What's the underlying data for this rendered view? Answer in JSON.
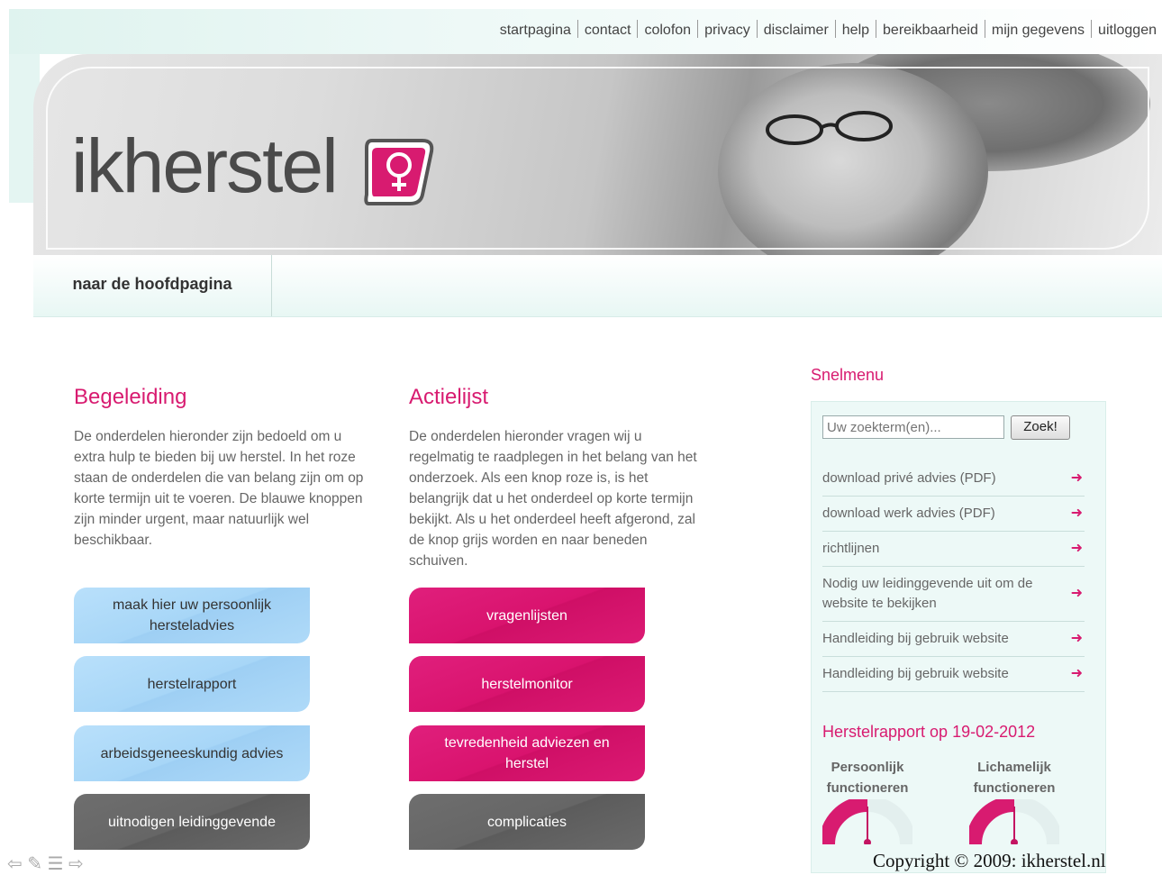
{
  "topnav": [
    "startpagina",
    "contact",
    "colofon",
    "privacy",
    "disclaimer",
    "help",
    "bereikbaarheid",
    "mijn gegevens",
    "uitloggen"
  ],
  "logo": {
    "text": "ikherstel",
    "icon": "female-symbol-leaf-icon"
  },
  "subnav": {
    "home": "naar de hoofdpagina"
  },
  "begeleiding": {
    "title": "Begeleiding",
    "text": "De onderdelen hieronder zijn bedoeld om u extra hulp te bieden bij uw herstel. In het roze staan de onderdelen die van belang zijn om op korte termijn uit te voeren. De blauwe knoppen zijn minder urgent, maar natuurlijk wel beschikbaar.",
    "buttons": [
      "maak hier uw persoonlijk hersteladvies",
      "herstelrapport",
      "arbeidsgeneeskundig advies",
      "uitnodigen leidinggevende"
    ]
  },
  "actielijst": {
    "title": "Actielijst",
    "text": "De onderdelen hieronder vragen wij u regelmatig te raadplegen in het belang van het onderzoek. Als een knop roze is, is het belangrijk dat u het onderdeel op korte termijn bekijkt. Als u het onderdeel heeft afgerond, zal de knop grijs worden en naar beneden schuiven.",
    "buttons": [
      "vragenlijsten",
      "herstelmonitor",
      "tevredenheid adviezen en herstel",
      "complicaties"
    ]
  },
  "snelmenu": {
    "title": "Snelmenu",
    "search_placeholder": "Uw zoekterm(en)...",
    "search_button": "Zoek!",
    "links": [
      "download privé advies (PDF)",
      "download werk advies (PDF)",
      "richtlijnen",
      "Nodig uw leidinggevende uit om de website te bekijken",
      "Handleiding bij gebruik website",
      "Handleiding bij gebruik website"
    ],
    "rapport_title": "Herstelrapport op 19-02-2012",
    "gauges": [
      {
        "label": "Persoonlijk functioneren"
      },
      {
        "label": "Lichamelijk functioneren"
      }
    ]
  },
  "colors": {
    "pink": "#d81b70",
    "blue": "#a7d6f7",
    "gray": "#666666",
    "mint": "#edf9f7"
  },
  "footer": {
    "copyright": "Copyright © 2009: ikherstel.nl",
    "icons": [
      "back-arrow-icon",
      "pencil-icon",
      "list-icon",
      "forward-arrow-icon"
    ]
  }
}
